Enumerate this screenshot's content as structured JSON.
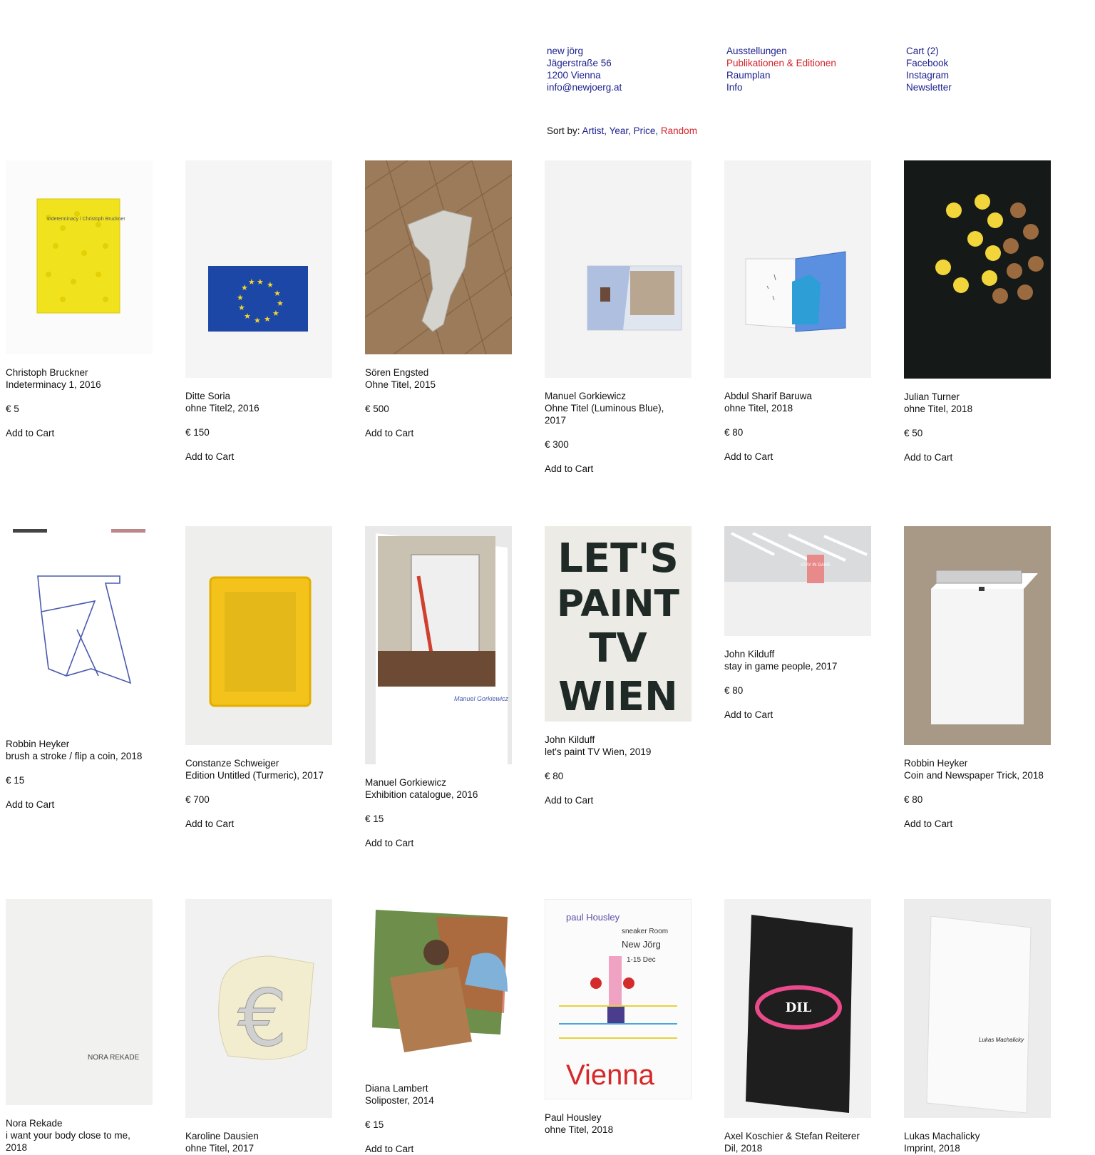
{
  "header": {
    "address": [
      "new jörg",
      "Jägerstraße 56",
      "1200 Vienna",
      "info@newjoerg.at"
    ],
    "nav": [
      {
        "label": "Ausstellungen",
        "active": false
      },
      {
        "label": "Publikationen & Editionen",
        "active": true
      },
      {
        "label": "Raumplan",
        "active": false
      },
      {
        "label": "Info",
        "active": false
      }
    ],
    "links": [
      "Cart (2)",
      "Facebook",
      "Instagram",
      "Newsletter"
    ]
  },
  "sort": {
    "prefix": "Sort by: ",
    "options": [
      {
        "label": "Artist",
        "active": false
      },
      {
        "label": "Year",
        "active": false
      },
      {
        "label": "Price",
        "active": false
      },
      {
        "label": "Random",
        "active": true
      }
    ]
  },
  "cart_label": "Add to Cart",
  "products": [
    {
      "artist": "Christoph Bruckner",
      "title": "Indeterminacy 1, 2016",
      "price": "€ 5"
    },
    {
      "artist": "Ditte Soria",
      "title": "ohne Titel2, 2016",
      "price": "€ 150"
    },
    {
      "artist": "Sören Engsted",
      "title": "Ohne Titel, 2015",
      "price": "€ 500"
    },
    {
      "artist": "Manuel Gorkiewicz",
      "title": "Ohne Titel (Luminous Blue), 2017",
      "price": "€ 300"
    },
    {
      "artist": "Abdul Sharif Baruwa",
      "title": "ohne Titel, 2018",
      "price": "€ 80"
    },
    {
      "artist": "Julian Turner",
      "title": "ohne Titel, 2018",
      "price": "€ 50"
    },
    {
      "artist": "Robbin Heyker",
      "title": "brush a stroke / flip a coin, 2018",
      "price": "€ 15"
    },
    {
      "artist": "Constanze Schweiger",
      "title": "Edition Untitled (Turmeric), 2017",
      "price": "€ 700"
    },
    {
      "artist": "Manuel Gorkiewicz",
      "title": "Exhibition catalogue, 2016",
      "price": "€ 15"
    },
    {
      "artist": "John Kilduff",
      "title": "let's paint TV Wien, 2019",
      "price": "€ 80"
    },
    {
      "artist": "John Kilduff",
      "title": "stay in game people, 2017",
      "price": "€ 80"
    },
    {
      "artist": "Robbin Heyker",
      "title": "Coin and Newspaper Trick, 2018",
      "price": "€ 80"
    },
    {
      "artist": "Nora Rekade",
      "title": "i want your body close to me, 2018",
      "price": ""
    },
    {
      "artist": "Karoline Dausien",
      "title": "ohne Titel, 2017",
      "price": ""
    },
    {
      "artist": "Diana Lambert",
      "title": "Soliposter, 2014",
      "price": "€ 15"
    },
    {
      "artist": "Paul Housley",
      "title": "ohne Titel, 2018",
      "price": ""
    },
    {
      "artist": "Axel Koschier & Stefan Reiterer",
      "title": "Dil, 2018",
      "price": ""
    },
    {
      "artist": "Lukas Machalicky",
      "title": "Imprint, 2018",
      "price": ""
    }
  ],
  "image_text": {
    "p1_cover": "Indeterminacy / Christoph Bruckner",
    "p10_poster": [
      "LET'S",
      "PAINT",
      "TV",
      "WIEN"
    ],
    "p11_sign": "STAY IN GAME",
    "p13_text": "NORA REKADE",
    "p14_symbol": "€",
    "p16_poster": [
      "paul Housley",
      "sneaker Room",
      "New Jörg",
      "1-15 Dec",
      "Vienna"
    ],
    "p17_cover": "DIL",
    "p18_signature": "Lukas Machalicky"
  }
}
